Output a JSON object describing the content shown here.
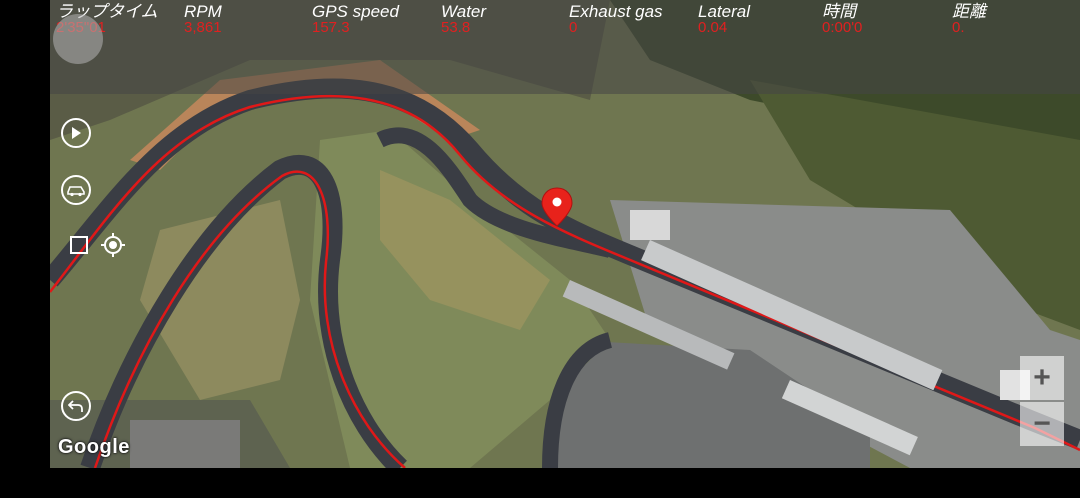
{
  "telemetry": [
    {
      "label": "ラップタイム",
      "value": "2'35\"01"
    },
    {
      "label": "RPM",
      "value": "3,861"
    },
    {
      "label": "GPS speed",
      "value": "157.3"
    },
    {
      "label": "Water",
      "value": "53.8"
    },
    {
      "label": "Exhaust gas",
      "value": "0"
    },
    {
      "label": "Lateral",
      "value": "0.04"
    },
    {
      "label": "時間",
      "value": "0:00'0"
    },
    {
      "label": "距離",
      "value": "0."
    }
  ],
  "map": {
    "attribution": "Google",
    "zoom_in": "+",
    "zoom_out": "−"
  },
  "controls": {
    "icons": [
      "play-icon",
      "car-icon",
      "checkbox-icon",
      "locate-icon",
      "back-icon",
      "pin-icon"
    ]
  },
  "colors": {
    "value_red": "#e02020",
    "track_line": "#e01818",
    "marker": "#e8221b"
  }
}
